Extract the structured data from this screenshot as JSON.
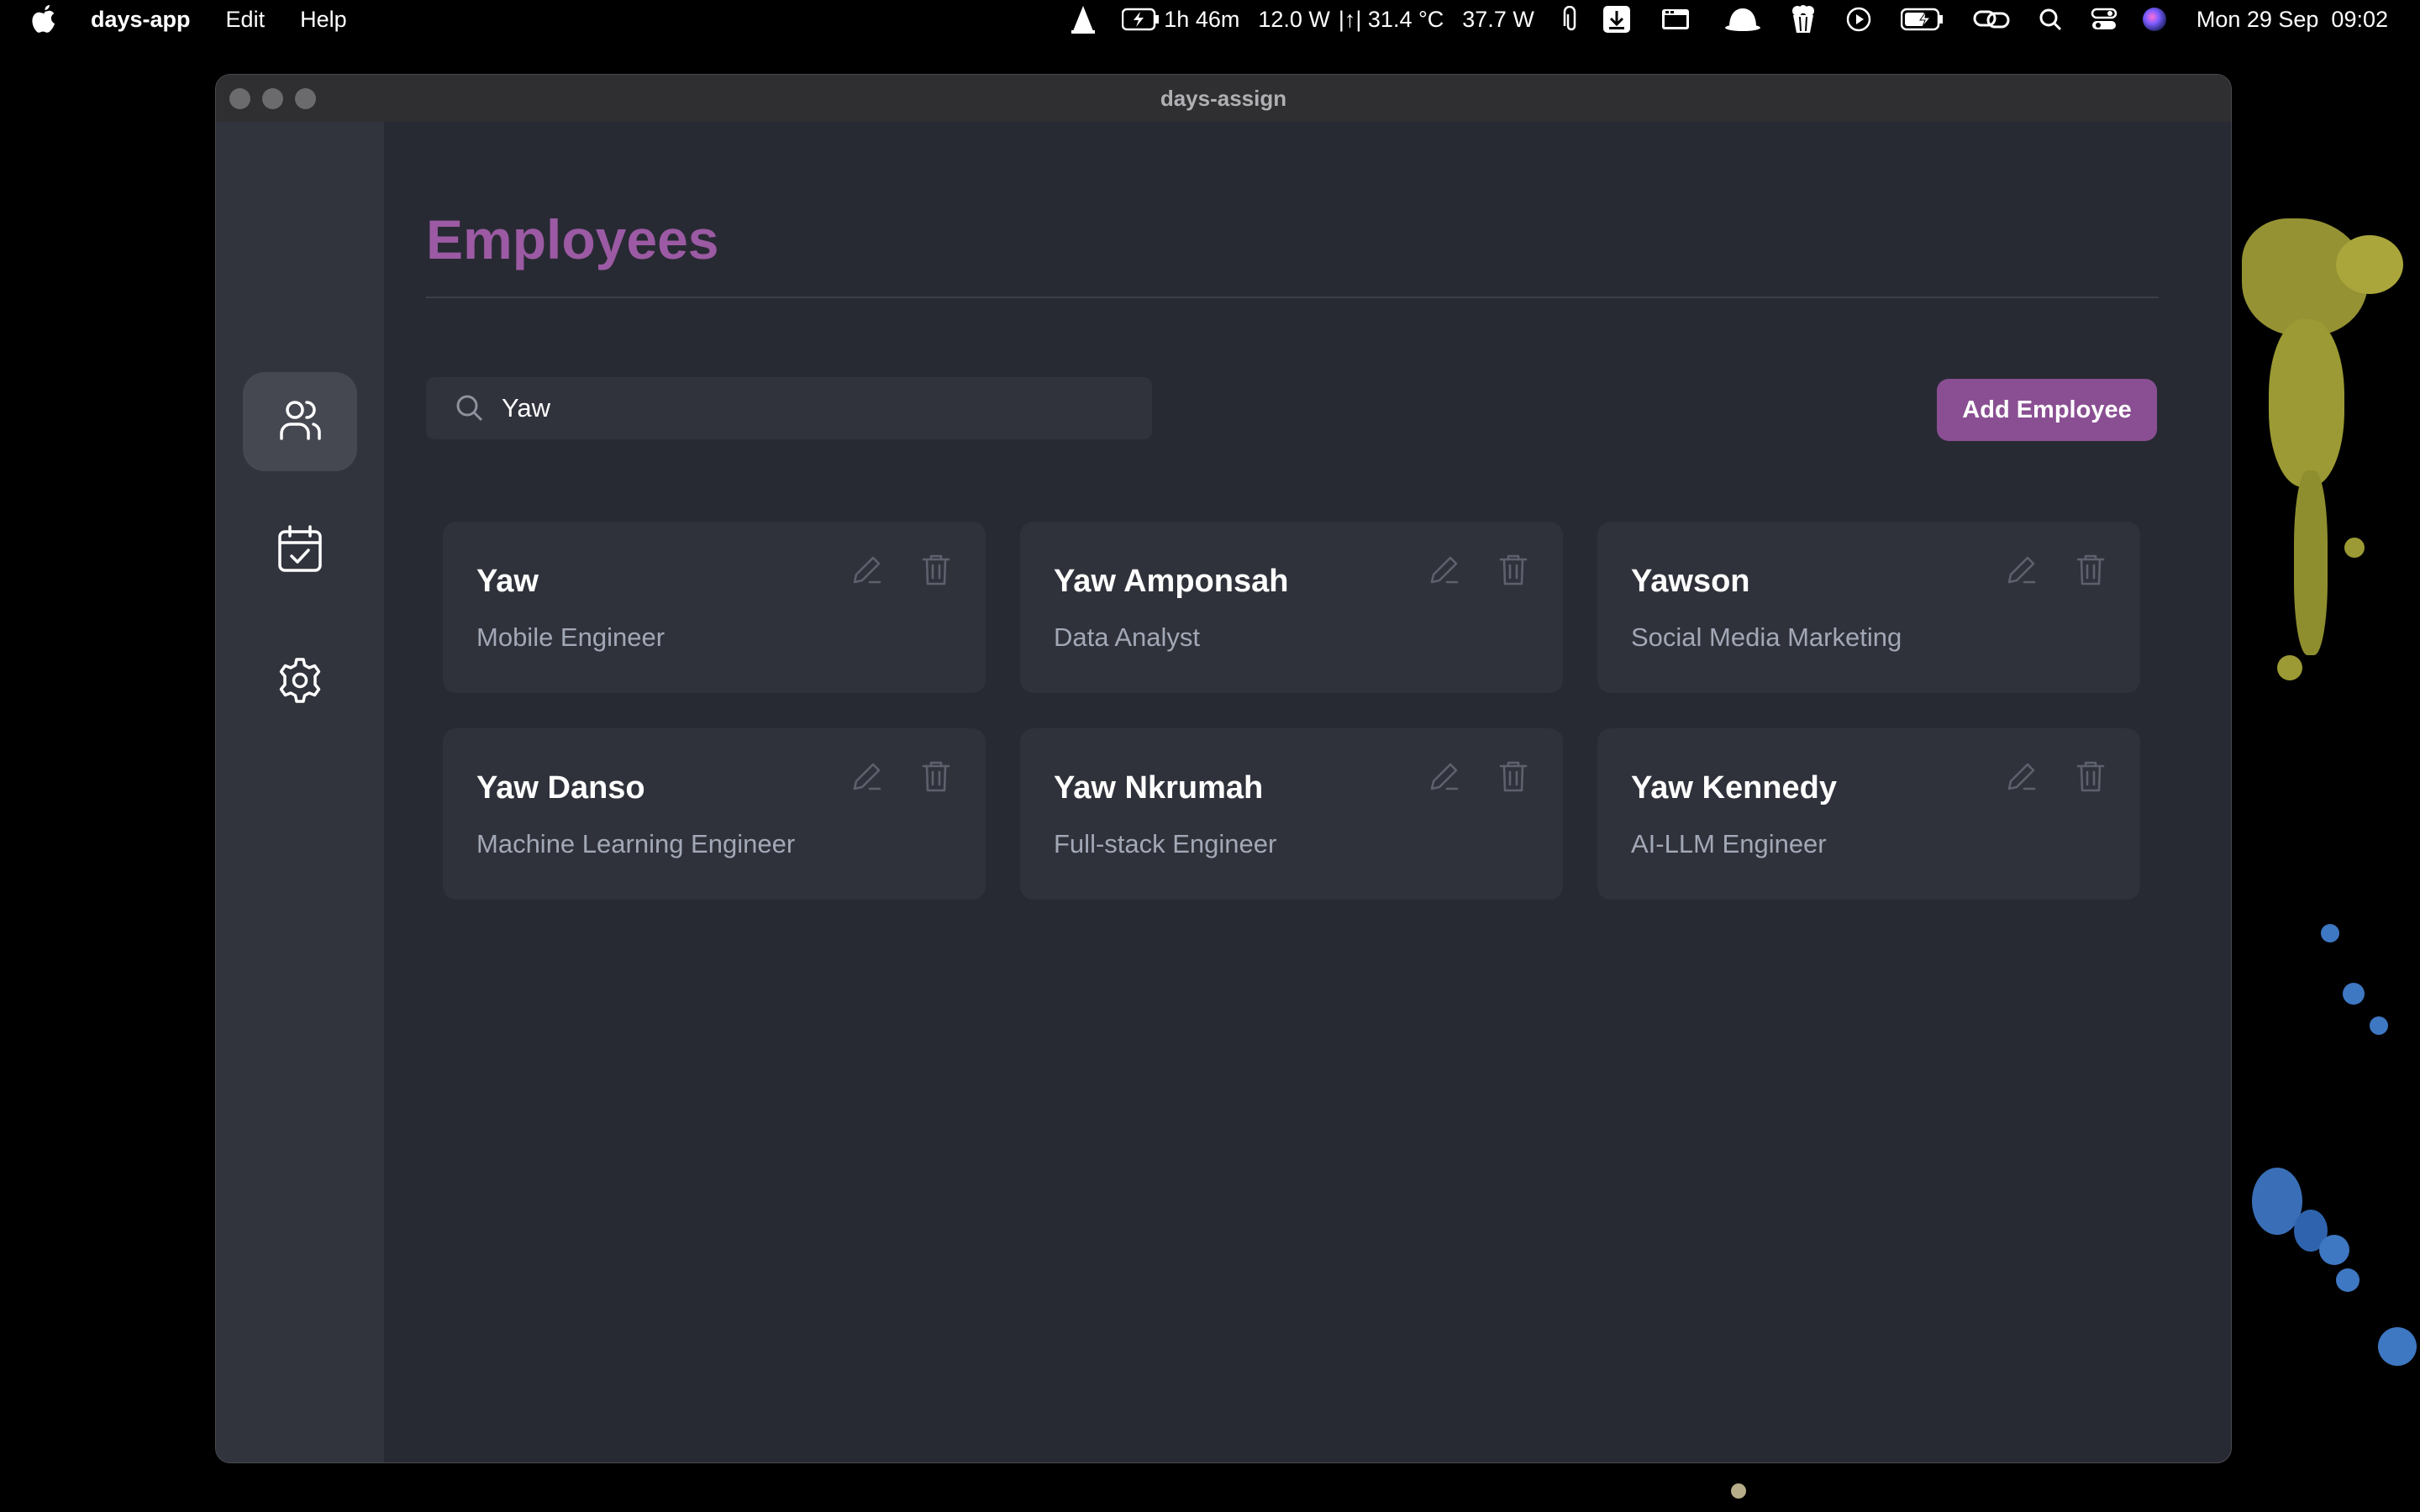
{
  "menubar": {
    "app_name": "days-app",
    "menus": [
      "Edit",
      "Help"
    ],
    "status": {
      "battery_time": "1h 46m",
      "power_in": "12.0 W",
      "temperature": "|↑| 31.4 °C",
      "power_draw": "37.7 W",
      "datetime": "Mon 29 Sep  09:02"
    }
  },
  "window": {
    "title": "days-assign"
  },
  "sidebar": {
    "items": [
      {
        "name": "employees",
        "icon": "users-icon",
        "active": true
      },
      {
        "name": "assignments",
        "icon": "calendar-check-icon",
        "active": false
      },
      {
        "name": "settings",
        "icon": "gear-icon",
        "active": false
      }
    ]
  },
  "main": {
    "title": "Employees",
    "search": {
      "value": "Yaw",
      "placeholder": ""
    },
    "add_button_label": "Add Employee",
    "employees": [
      {
        "name": "Yaw",
        "role": "Mobile Engineer"
      },
      {
        "name": "Yaw Amponsah",
        "role": "Data Analyst"
      },
      {
        "name": "Yawson",
        "role": "Social Media Marketing"
      },
      {
        "name": "Yaw Danso",
        "role": "Machine Learning Engineer"
      },
      {
        "name": "Yaw Nkrumah",
        "role": "Full-stack Engineer"
      },
      {
        "name": "Yaw Kennedy",
        "role": "AI-LLM Engineer"
      }
    ]
  },
  "colors": {
    "accent": "#9b5aa3",
    "button": "#8a4f93",
    "window_bg": "#282a33",
    "card_bg": "#30323b",
    "sidebar_bg": "#31343d"
  }
}
